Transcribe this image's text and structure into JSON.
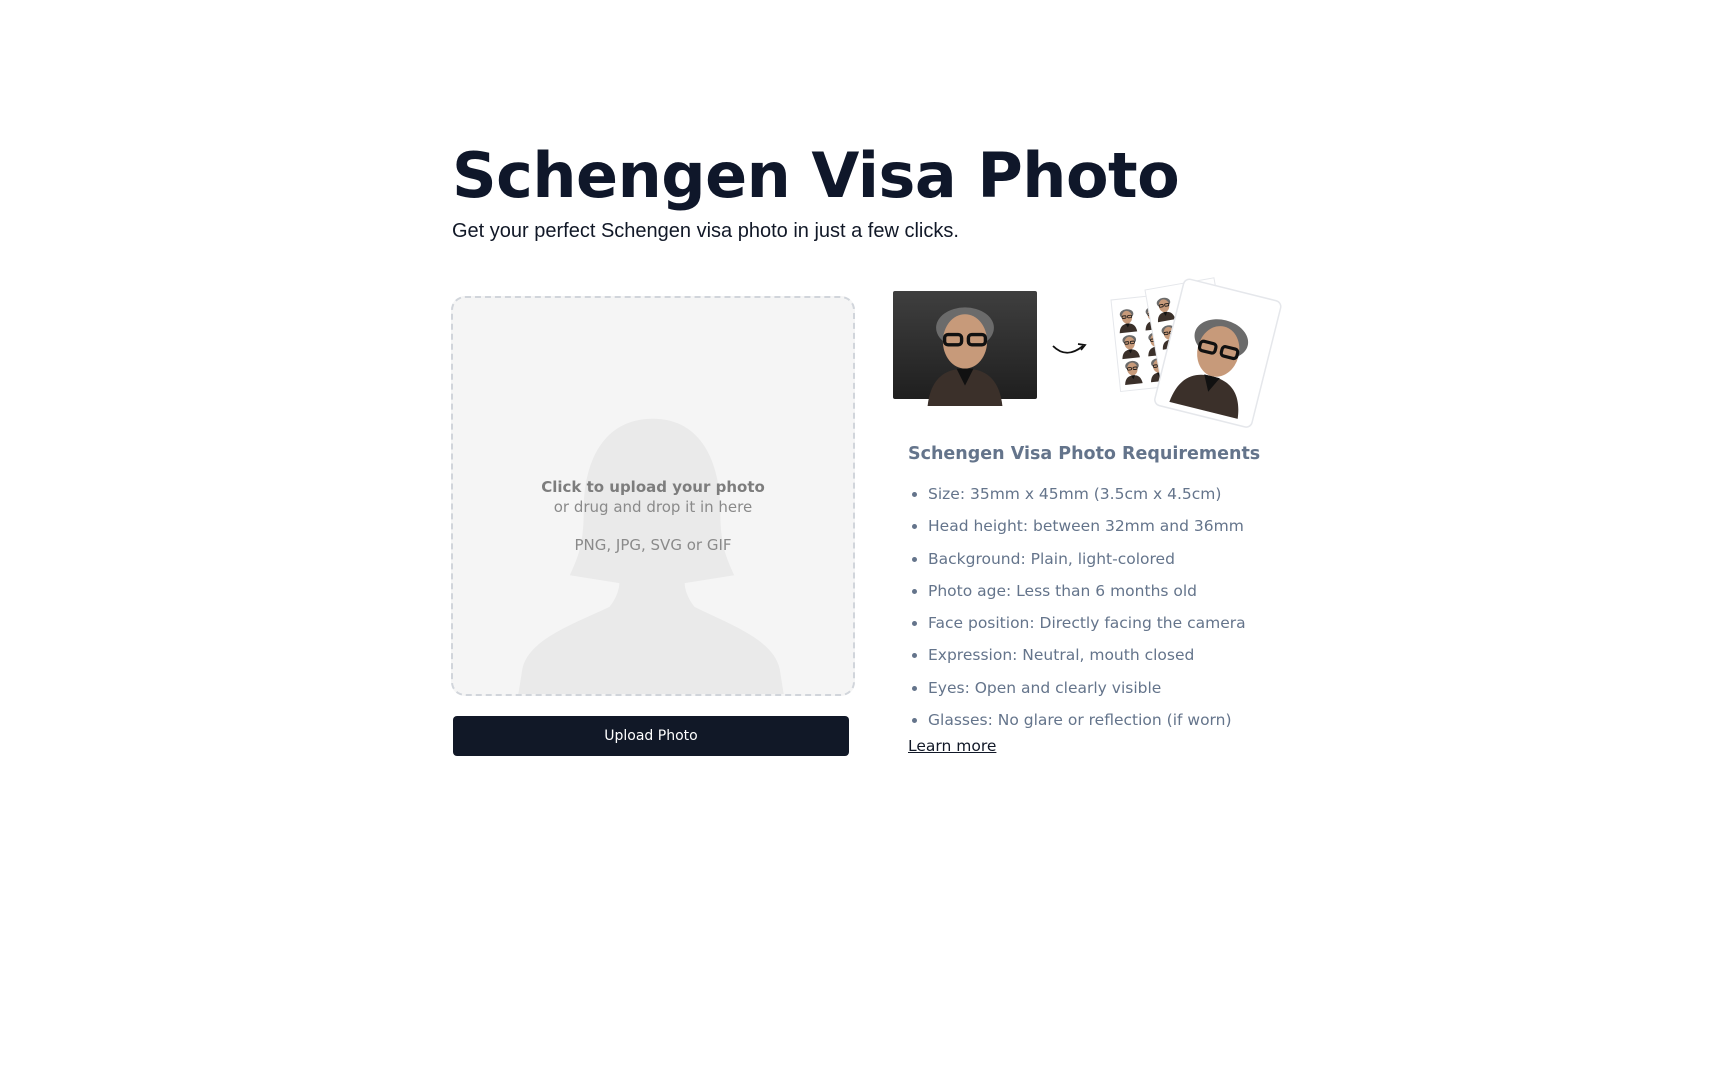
{
  "header": {
    "title": "Schengen Visa Photo",
    "subtitle": "Get your perfect Schengen visa photo in just a few clicks."
  },
  "upload": {
    "title": "Click to upload your photo",
    "subtitle": "or drug and drop it in here",
    "formats": "PNG, JPG, SVG or GIF",
    "button_label": "Upload Photo"
  },
  "requirements": {
    "heading": "Schengen Visa Photo Requirements",
    "items": [
      "Size: 35mm x 45mm (3.5cm x 4.5cm)",
      "Head height: between 32mm and 36mm",
      "Background: Plain, light-colored",
      "Photo age: Less than 6 months old",
      "Face position: Directly facing the camera",
      "Expression: Neutral, mouth closed",
      "Eyes: Open and clearly visible",
      "Glasses: No glare or reflection (if worn)"
    ],
    "learn_more": "Learn more"
  },
  "colors": {
    "primary": "#111827",
    "muted_text": "#64748b",
    "dropzone_bg": "#f5f5f5"
  }
}
